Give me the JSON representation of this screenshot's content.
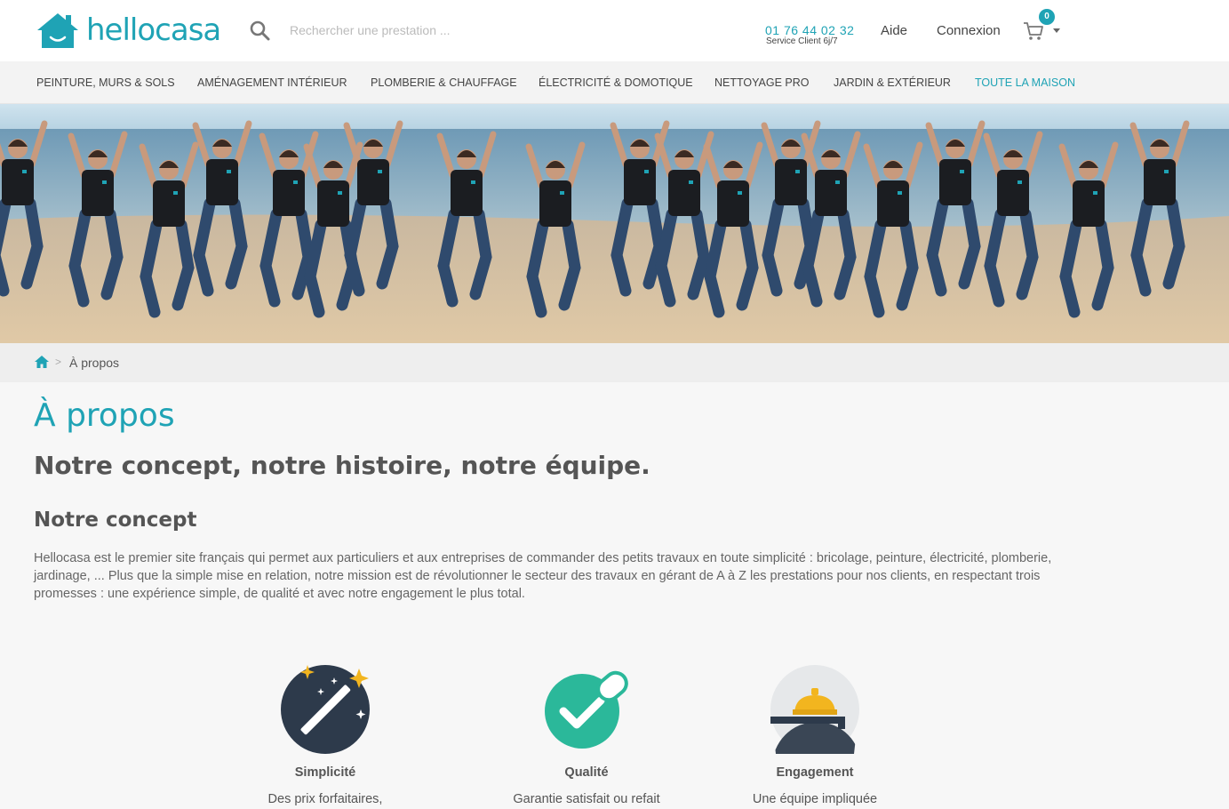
{
  "header": {
    "logo_text": "hellocasa",
    "search_placeholder": "Rechercher une prestation ...",
    "phone": "01 76 44 02 32",
    "phone_sub": "Service Client 6j/7",
    "help_label": "Aide",
    "login_label": "Connexion",
    "cart_count": "0"
  },
  "nav": {
    "items": [
      "PEINTURE, MURS & SOLS",
      "AMÉNAGEMENT INTÉRIEUR",
      "PLOMBERIE & CHAUFFAGE",
      "ÉLECTRICITÉ & DOMOTIQUE",
      "NETTOYAGE PRO",
      "JARDIN & EXTÉRIEUR",
      "TOUTE LA MAISON"
    ],
    "active_index": 6
  },
  "breadcrumb": {
    "separator": ">",
    "current": "À propos"
  },
  "content": {
    "title": "À propos",
    "subtitle": "Notre concept, notre histoire, notre équipe.",
    "section_title": "Notre concept",
    "paragraph": "Hellocasa est le premier site français qui permet aux particuliers et aux entreprises de commander des petits travaux en toute simplicité : bricolage, peinture, électricité, plomberie, jardinage, ... Plus que la simple mise en relation, notre mission est de révolutionner le secteur des travaux en gérant de A à Z les prestations pour nos clients, en respectant trois promesses : une expérience simple, de qualité et avec notre engagement le plus total."
  },
  "features": [
    {
      "title": "Simplicité",
      "desc": "Des prix forfaitaires,",
      "icon": "magic-wand-icon"
    },
    {
      "title": "Qualité",
      "desc": "Garantie satisfait ou refait",
      "icon": "checkmark-badge-icon"
    },
    {
      "title": "Engagement",
      "desc": "Une équipe impliquée",
      "icon": "service-bell-icon"
    }
  ],
  "colors": {
    "brand": "#1fa3b5",
    "simplicity_bg": "#2d3a4b",
    "quality_bg": "#2bb89a",
    "engagement_bell": "#f2b51f"
  }
}
